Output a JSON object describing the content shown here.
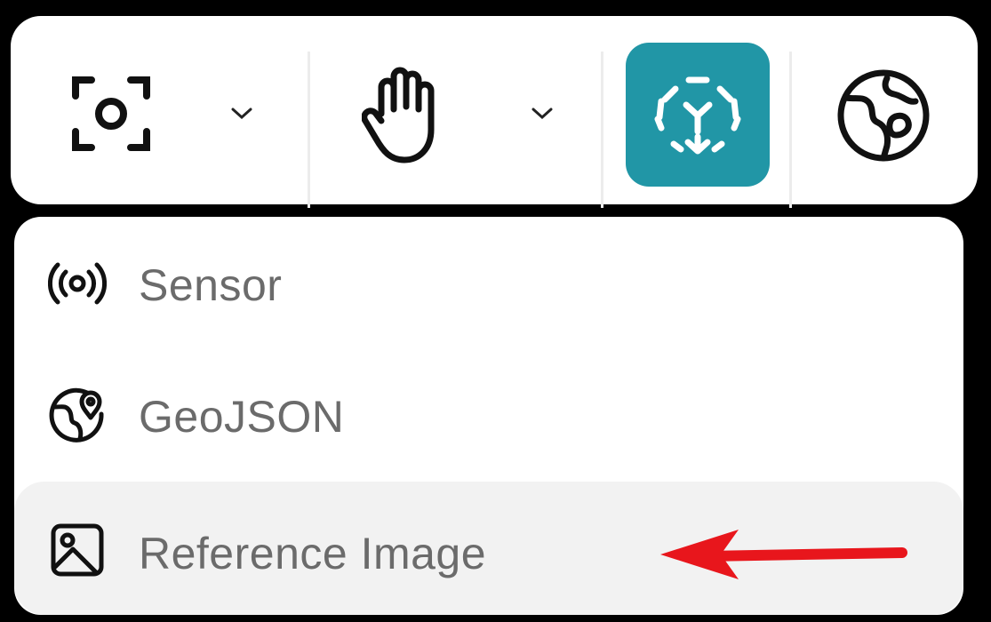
{
  "toolbar": {
    "tools": [
      {
        "name": "camera-focus",
        "icon": "focus-frame-icon",
        "has_dropdown": true
      },
      {
        "name": "pan",
        "icon": "hand-icon",
        "has_dropdown": true
      },
      {
        "name": "transform",
        "icon": "move-arrows-icon",
        "active": true
      },
      {
        "name": "globe",
        "icon": "globe-icon"
      }
    ],
    "active_color": "#2196a6"
  },
  "menu": {
    "items": [
      {
        "label": "Sensor",
        "icon": "sensor-broadcast-icon"
      },
      {
        "label": "GeoJSON",
        "icon": "globe-pin-icon"
      },
      {
        "label": "Reference Image",
        "icon": "image-icon",
        "highlighted": true
      }
    ]
  },
  "annotation": {
    "type": "arrow",
    "color": "#e8161c",
    "points_to": "Reference Image"
  }
}
